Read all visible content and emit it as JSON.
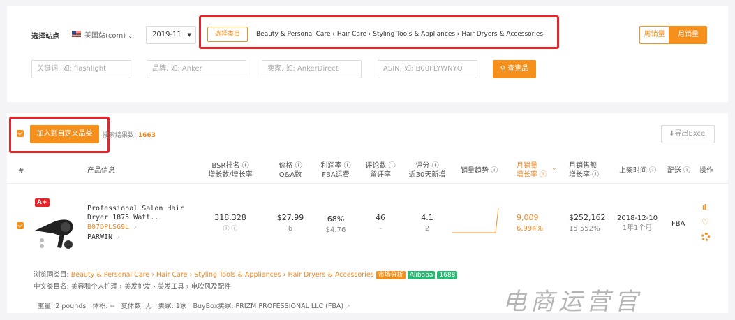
{
  "filters": {
    "site_label": "选择站点",
    "site_value": "美国站(com)",
    "month_value": "2019-11",
    "category_button": "选择类目",
    "breadcrumb": [
      "Beauty & Personal Care",
      "Hair Care",
      "Styling Tools & Appliances",
      "Hair Dryers & Accessories"
    ],
    "toggle_weekly": "周销量",
    "toggle_monthly": "月销量",
    "keyword_placeholder": "关键词, 如: flashlight",
    "brand_placeholder": "品牌, 如: Anker",
    "seller_placeholder": "卖家, 如: AnkerDirect",
    "asin_placeholder": "ASIN, 如: B00FLYWNYQ",
    "search_button": "查竞品"
  },
  "results": {
    "add_button": "加入到自定义品类",
    "count_label": "搜索结果数:",
    "count_value": "1663",
    "export_label": "导出Excel"
  },
  "columns": {
    "index": "#",
    "product": "产品信息",
    "bsr": [
      "BSR排名 ⓘ",
      "增长数/增长率"
    ],
    "price": [
      "价格 ⓘ",
      "Q&A数"
    ],
    "profit": [
      "利润率 ⓘ",
      "FBA运费"
    ],
    "reviews": [
      "评论数 ⓘ",
      "留评率"
    ],
    "rating": [
      "评分 ⓘ",
      "近30天新增"
    ],
    "trend": "销量趋势 ⓘ",
    "monthly_sales": [
      "月销量",
      "增长率 ⓘ"
    ],
    "monthly_revenue": [
      "月销售额",
      "增长率 ⓘ"
    ],
    "listed": "上架时间 ⓘ",
    "delivery": "配送 ⓘ",
    "actions": "操作"
  },
  "product": {
    "badge": "A+",
    "title_line1": "Professional Salon Hair",
    "title_line2": "Dryer 1875 Watt...",
    "asin": "B07DPLSG9L",
    "brand": "PARWIN",
    "bsr": "318,328",
    "bsr_growth": "ⓘ ⓘ",
    "price": "$27.99",
    "qa": "6",
    "profit_rate": "68%",
    "fba_fee": "$4.76",
    "reviews": "46",
    "review_rate": "-",
    "rating": "4.1",
    "rating_new": "2",
    "monthly_sales": "9,009",
    "sales_growth": "6,994%",
    "revenue": "$252,162",
    "revenue_growth": "15,552%",
    "listed_date": "2018-12-10",
    "listed_age": "1年1个月",
    "delivery": "FBA",
    "browse_label": "浏览同类目:",
    "browse_path": "Beauty & Personal Care › Hair Care › Styling Tools & Appliances › Hair Dryers & Accessories",
    "tag_market": "市场分析",
    "tag_alibaba": "Alibaba",
    "tag_1688": "1688",
    "cn_category": "中文类目名: 美容和个人护理 › 美发护发 › 美发工具 › 电吹风及配件",
    "details": "重量: 2 pounds   体积: --   变体数: 无   卖家: 1家   BuyBox卖家: PRIZM PROFESSIONAL LLC (FBA)"
  },
  "watermark": "电商运营官",
  "colors": {
    "accent": "#f5901d",
    "highlight": "#e8232a",
    "green": "#2bb673"
  }
}
